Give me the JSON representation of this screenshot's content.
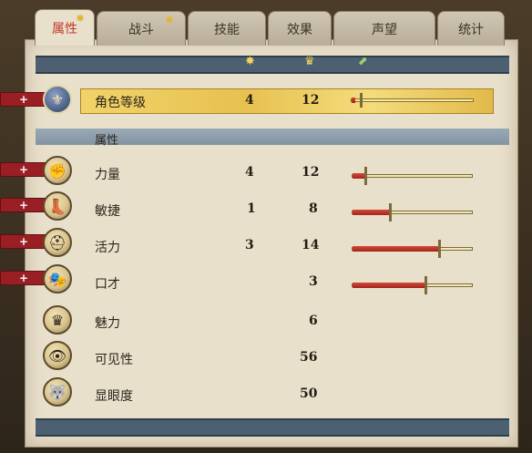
{
  "tabs": [
    {
      "label": "属性",
      "active": true,
      "star": true
    },
    {
      "label": "战斗",
      "active": false,
      "star": true
    },
    {
      "label": "技能",
      "active": false,
      "star": false
    },
    {
      "label": "效果",
      "active": false,
      "star": false
    },
    {
      "label": "声望",
      "active": false,
      "star": false
    },
    {
      "label": "统计",
      "active": false,
      "star": false
    }
  ],
  "header_icons": [
    "star-icon",
    "crown-icon",
    "up-arrow-icon"
  ],
  "level": {
    "label": "角色等级",
    "value": "4",
    "total": "12",
    "progress": 0.03
  },
  "section_title": "属性",
  "attributes": [
    {
      "name": "力量",
      "base": "4",
      "total": "12",
      "icon": "fist-icon",
      "plus": true,
      "progress": 0.1
    },
    {
      "name": "敏捷",
      "base": "1",
      "total": "8",
      "icon": "boot-icon",
      "plus": true,
      "progress": 0.3
    },
    {
      "name": "活力",
      "base": "3",
      "total": "14",
      "icon": "helmet-icon",
      "plus": true,
      "progress": 0.72
    },
    {
      "name": "口才",
      "base": "",
      "total": "3",
      "icon": "mask-icon",
      "plus": true,
      "progress": 0.6
    },
    {
      "name": "魅力",
      "base": "",
      "total": "6",
      "icon": "crown-icon",
      "plus": false
    },
    {
      "name": "可见性",
      "base": "",
      "total": "56",
      "icon": "eye-icon",
      "plus": false
    },
    {
      "name": "显眼度",
      "base": "",
      "total": "50",
      "icon": "wolf-icon",
      "plus": false
    }
  ],
  "plus_symbol": "+",
  "colors": {
    "accent_red": "#9a1f24",
    "band_blue": "#4c6072",
    "gold": "#e7c150"
  }
}
